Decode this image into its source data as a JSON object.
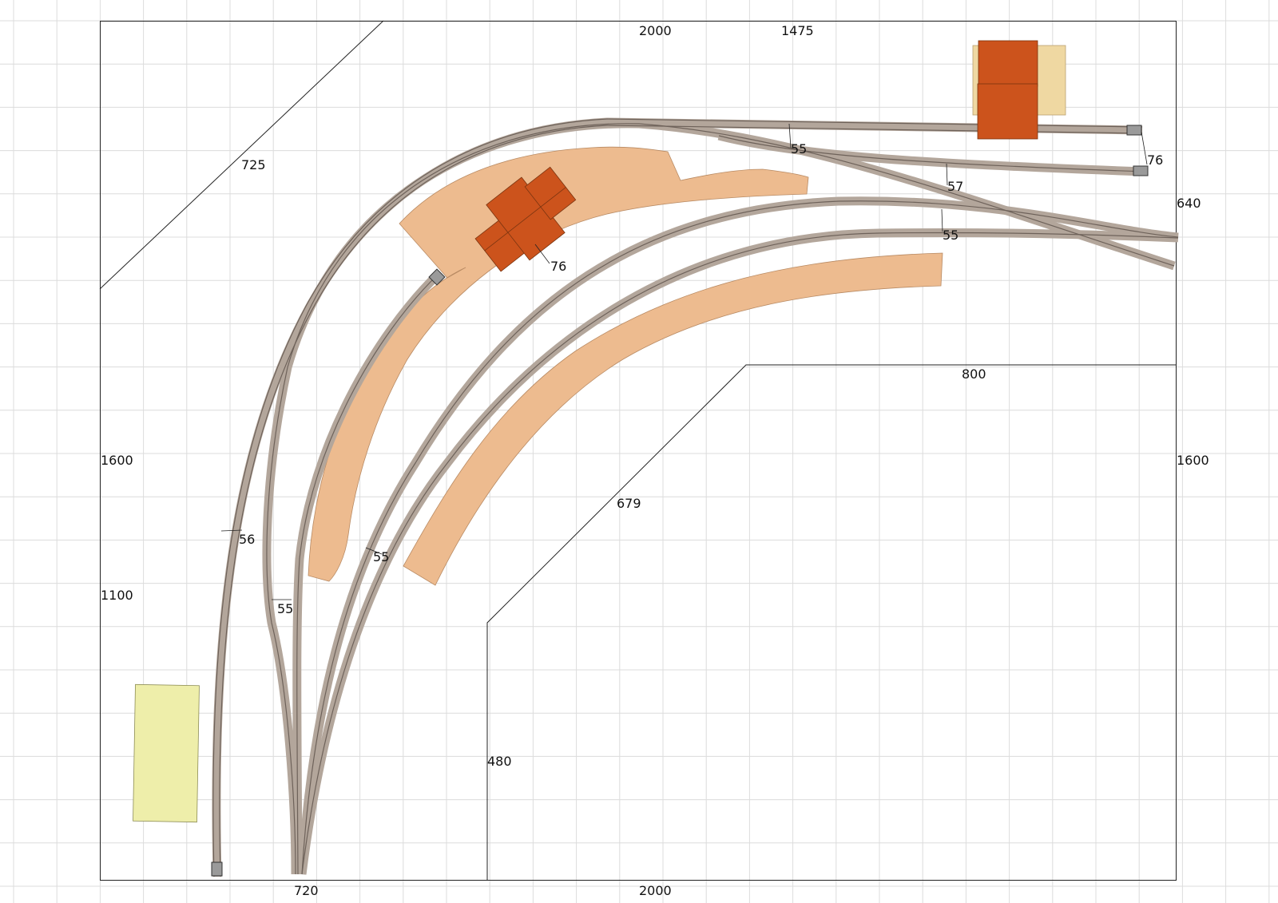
{
  "colors": {
    "grid": "#dcdcdc",
    "background": "#ffffff",
    "outline": "#222222",
    "track_bed": "#b3a69b",
    "track_rail": "#6e625a",
    "platform": "#edbb8f",
    "building_red": "#cc531c",
    "building_tan": "#efd8a2",
    "yard_yellow": "#eeeeaa",
    "buffer_grey": "#9a9a9a"
  },
  "dimensions": {
    "top_2000": "2000",
    "top_1475": "1475",
    "diag_725": "725",
    "right_640": "640",
    "left_1600": "1600",
    "right_1600": "1600",
    "left_1100": "1100",
    "inner_800": "800",
    "diag_679": "679",
    "inner_480": "480",
    "bottom_720": "720",
    "bottom_2000": "2000"
  },
  "track_labels": {
    "t55_top": "55",
    "t76_right": "76",
    "t57": "57",
    "t55_mid": "55",
    "t76_shed": "76",
    "t56": "56",
    "t55_left": "55",
    "t55_lower": "55"
  }
}
